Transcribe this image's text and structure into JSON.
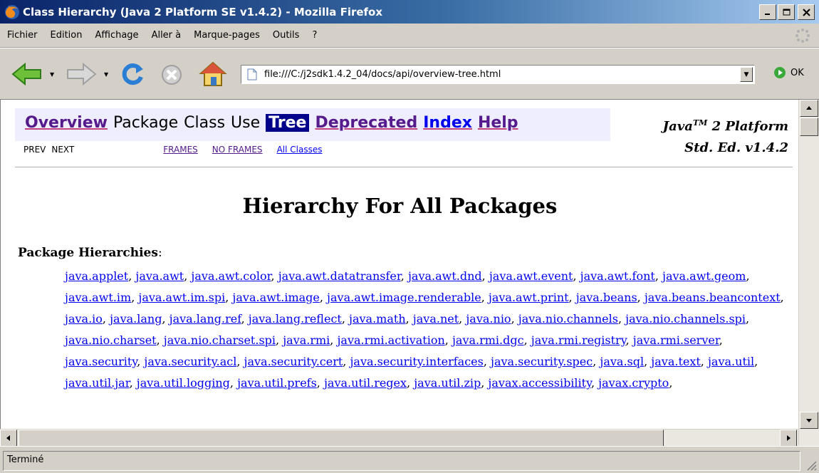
{
  "window": {
    "title": "Class Hierarchy (Java 2 Platform SE v1.4.2) - Mozilla Firefox",
    "minimize_label": "_",
    "maximize_label": "□",
    "close_label": "×"
  },
  "menubar": {
    "items": [
      "Fichier",
      "Edition",
      "Affichage",
      "Aller à",
      "Marque-pages",
      "Outils",
      "?"
    ]
  },
  "toolbar": {
    "url": "file:///C:/j2sdk1.4.2_04/docs/api/overview-tree.html",
    "go_label": "OK",
    "dropdown_glyph": "▼"
  },
  "javadoc": {
    "nav": {
      "overview": "Overview",
      "package": "Package",
      "class": "Class",
      "use": "Use",
      "tree": "Tree",
      "deprecated": "Deprecated",
      "index": "Index",
      "help": "Help"
    },
    "subnav": {
      "prev": "PREV",
      "next": "NEXT",
      "frames": "FRAMES",
      "no_frames": "NO FRAMES",
      "all_classes": "All Classes"
    },
    "platform_line1_prefix": "Java",
    "platform_line1_sup": "TM",
    "platform_line1_suffix": " 2 Platform",
    "platform_line2": "Std. Ed. v1.4.2",
    "heading": "Hierarchy For All Packages",
    "package_label": "Package Hierarchies",
    "package_label_colon": ":",
    "packages": [
      "java.applet",
      "java.awt",
      "java.awt.color",
      "java.awt.datatransfer",
      "java.awt.dnd",
      "java.awt.event",
      "java.awt.font",
      "java.awt.geom",
      "java.awt.im",
      "java.awt.im.spi",
      "java.awt.image",
      "java.awt.image.renderable",
      "java.awt.print",
      "java.beans",
      "java.beans.beancontext",
      "java.io",
      "java.lang",
      "java.lang.ref",
      "java.lang.reflect",
      "java.math",
      "java.net",
      "java.nio",
      "java.nio.channels",
      "java.nio.channels.spi",
      "java.nio.charset",
      "java.nio.charset.spi",
      "java.rmi",
      "java.rmi.activation",
      "java.rmi.dgc",
      "java.rmi.registry",
      "java.rmi.server",
      "java.security",
      "java.security.acl",
      "java.security.cert",
      "java.security.interfaces",
      "java.security.spec",
      "java.sql",
      "java.text",
      "java.util",
      "java.util.jar",
      "java.util.logging",
      "java.util.prefs",
      "java.util.regex",
      "java.util.zip",
      "javax.accessibility",
      "javax.crypto"
    ]
  },
  "statusbar": {
    "text": "Terminé"
  },
  "colors": {
    "titlebar_start": "#0a246a",
    "titlebar_end": "#a6caf0",
    "chrome": "#d4d0c8",
    "navbar_bg": "#eeeeff",
    "nav_current_bg": "#00008b",
    "link_blue": "#0000ee",
    "link_visited": "#551a8b"
  }
}
